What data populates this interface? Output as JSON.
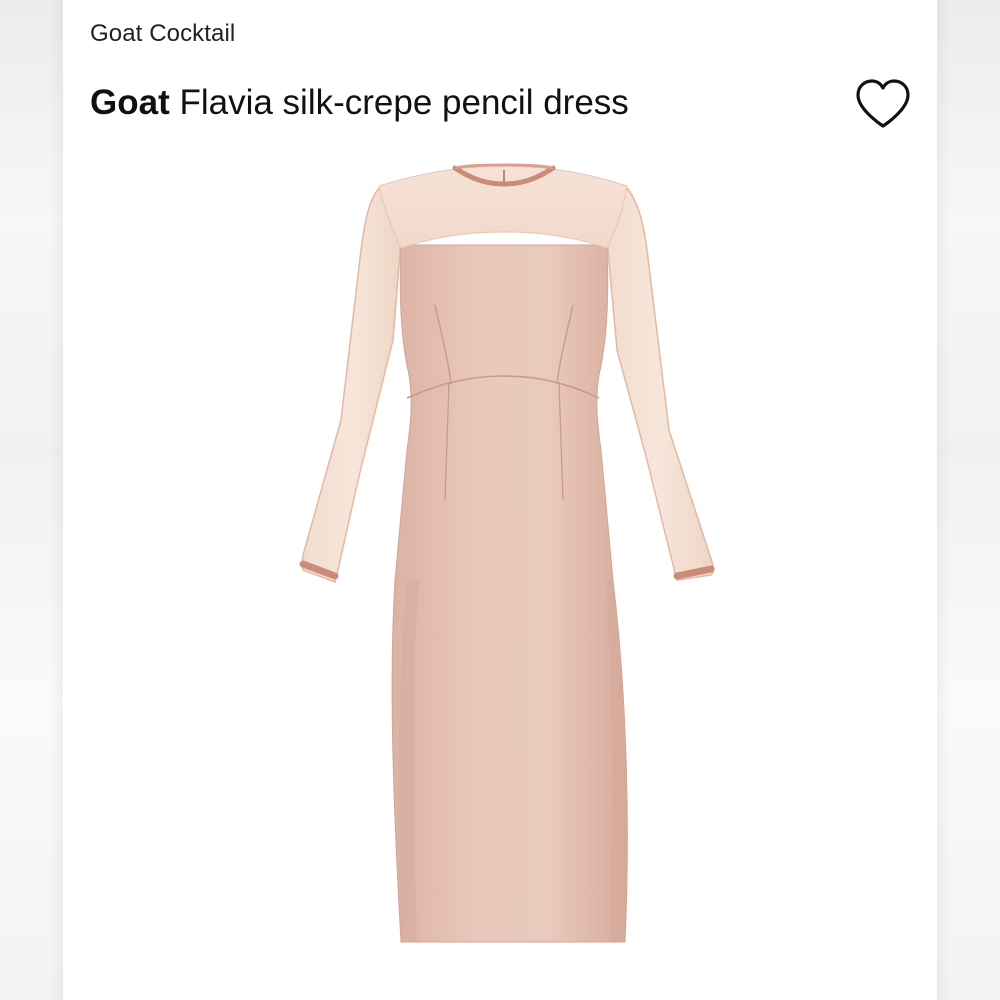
{
  "listing": {
    "category_label": "Goat Cocktail",
    "brand": "Goat",
    "product_name": "Flavia silk-crepe pencil dress"
  },
  "icons": {
    "favorite": "heart-outline-icon"
  },
  "product_image": {
    "depicts": "pink long-sleeve dress with sheer yoke and sleeves",
    "dress_color": "#e7c2b6",
    "trim_color": "#c98c78"
  }
}
